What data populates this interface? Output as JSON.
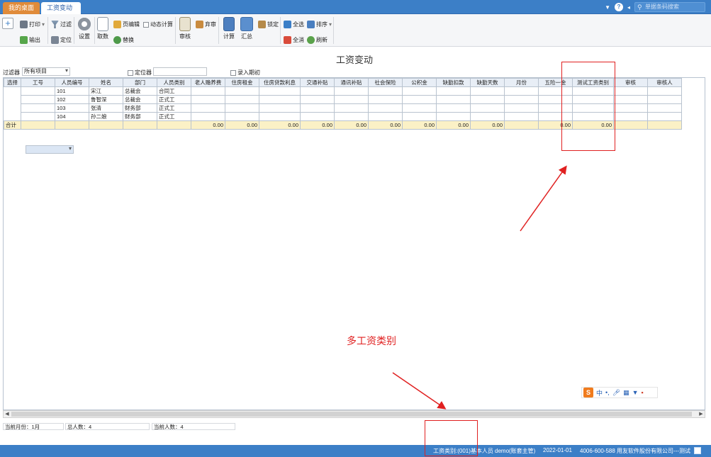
{
  "tabs": {
    "home": "我的桌面",
    "active": "工资变动",
    "close": "×"
  },
  "topbar": {
    "search_placeholder": "单据条码搜索"
  },
  "toolbar": {
    "add": "+",
    "print": "打印",
    "export": "输出",
    "filter": "过滤",
    "locate": "定位",
    "settings": "设置",
    "fetch": "取数",
    "page_edit": "页编辑",
    "replace": "替换",
    "dynamic_calc": "动态计算",
    "audit": "审核",
    "abandon_audit": "弃审",
    "calculate": "计算",
    "summary": "汇总",
    "lock": "锁定",
    "select_all": "全选",
    "deselect_all": "全消",
    "sort": "排序",
    "refresh": "刷新"
  },
  "form_title": "工资变动",
  "filter_bar": {
    "label": "过滤器",
    "selected": "所有项目",
    "locator_label": "定位器",
    "enter_period_label": "录入期初"
  },
  "grid": {
    "columns": [
      "选择",
      "工号",
      "人员编号",
      "姓名",
      "部门",
      "人员类别",
      "老人赡养费",
      "住房租金",
      "住房贷款利息",
      "交通补贴",
      "通讯补贴",
      "社会保险",
      "公积金",
      "缺勤扣款",
      "缺勤天数",
      "月份",
      "五险一金",
      "测试工资类别",
      "审核",
      "审核人"
    ],
    "rows": [
      {
        "code": "101",
        "name": "宋江",
        "dept": "总裁会",
        "type": "合同工"
      },
      {
        "code": "102",
        "name": "鲁智深",
        "dept": "总裁会",
        "type": "正式工"
      },
      {
        "code": "103",
        "name": "张清",
        "dept": "财务部",
        "type": "正式工"
      },
      {
        "code": "104",
        "name": "孙二娘",
        "dept": "财务部",
        "type": "正式工"
      }
    ],
    "total_label": "合计",
    "totals": [
      "0.00",
      "0.00",
      "0.00",
      "0.00",
      "0.00",
      "0.00",
      "0.00",
      "0.00",
      "0.00",
      "",
      "0.00",
      "0.00"
    ]
  },
  "info": {
    "current_month": "当前月份：1月",
    "total_people": "总人数：4",
    "current_people": "当前人数：4"
  },
  "status": {
    "salary_type": "工资类别:(001)基本人员",
    "user": "demo(账套主管)",
    "date": "2022-01-01",
    "company": "4006-600-588 用友软件股份有限公司---测试"
  },
  "annotation": {
    "text": "多工资类别"
  },
  "ime": {
    "cn": "中",
    "logo": "S"
  }
}
